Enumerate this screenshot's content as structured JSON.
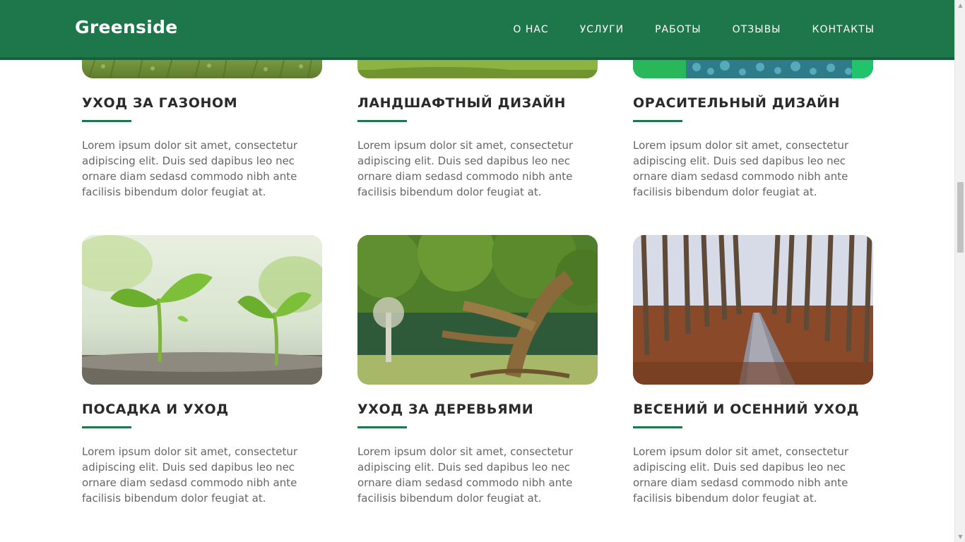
{
  "nav": {
    "brand": "Greenside",
    "items": [
      {
        "label": "О НАС"
      },
      {
        "label": "УСЛУГИ"
      },
      {
        "label": "РАБОТЫ"
      },
      {
        "label": "ОТЗЫВЫ"
      },
      {
        "label": "КОНТАКТЫ"
      }
    ]
  },
  "colors": {
    "brand": "#1e774a",
    "accent_rule": "#1e774a",
    "text": "#666666"
  },
  "services": [
    {
      "title": "УХОД ЗА ГАЗОНОМ",
      "text": "Lorem ipsum dolor sit amet, consectetur adipiscing elit. Duis sed dapibus leo nec ornare diam sedasd commodo nibh ante facilisis bibendum dolor feugiat at.",
      "image": "lawn-photo"
    },
    {
      "title": "ЛАНДШАФТНЫЙ ДИЗАЙН",
      "text": "Lorem ipsum dolor sit amet, consectetur adipiscing elit. Duis sed dapibus leo nec ornare diam sedasd commodo nibh ante facilisis bibendum dolor feugiat at.",
      "image": "landscape-photo"
    },
    {
      "title": "ОРАСИТЕЛЬНЫЙ ДИЗАЙН",
      "text": "Lorem ipsum dolor sit amet, consectetur adipiscing elit. Duis sed dapibus leo nec ornare diam sedasd commodo nibh ante facilisis bibendum dolor feugiat at.",
      "image": "water-drops-photo"
    },
    {
      "title": "ПОСАДКА И УХОД",
      "text": "Lorem ipsum dolor sit amet, consectetur adipiscing elit. Duis sed dapibus leo nec ornare diam sedasd commodo nibh ante facilisis bibendum dolor feugiat at.",
      "image": "seedlings-photo"
    },
    {
      "title": "УХОД ЗА ДЕРЕВЬЯМИ",
      "text": "Lorem ipsum dolor sit amet, consectetur adipiscing elit. Duis sed dapibus leo nec ornare diam sedasd commodo nibh ante facilisis bibendum dolor feugiat at.",
      "image": "old-tree-photo"
    },
    {
      "title": "ВЕСЕНИЙ И ОСЕННИЙ УХОД",
      "text": "Lorem ipsum dolor sit amet, consectetur adipiscing elit. Duis sed dapibus leo nec ornare diam sedasd commodo nibh ante facilisis bibendum dolor feugiat at.",
      "image": "autumn-alley-photo"
    }
  ]
}
